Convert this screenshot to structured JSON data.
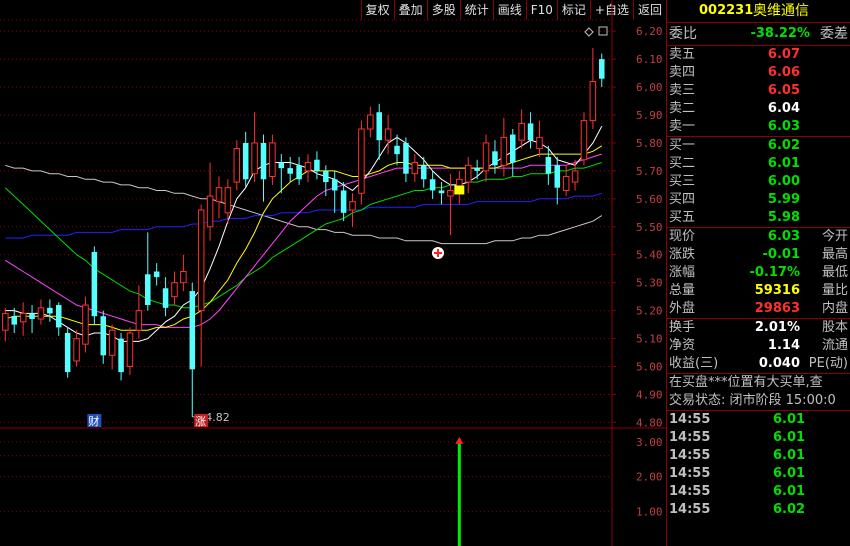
{
  "toolbar": [
    "复权",
    "叠加",
    "多股",
    "统计",
    "画线",
    "F10",
    "标记",
    "+自选",
    "返回"
  ],
  "stock": {
    "code": "002231",
    "name": "奥维通信"
  },
  "weibi": {
    "label": "委比",
    "value": "-38.22%",
    "label2": "委差"
  },
  "sell": [
    {
      "label": "卖五",
      "price": "6.07",
      "color": "red"
    },
    {
      "label": "卖四",
      "price": "6.06",
      "color": "red"
    },
    {
      "label": "卖三",
      "price": "6.05",
      "color": "red"
    },
    {
      "label": "卖二",
      "price": "6.04",
      "color": "white"
    },
    {
      "label": "卖一",
      "price": "6.03",
      "color": "green"
    }
  ],
  "buy": [
    {
      "label": "买一",
      "price": "6.02",
      "color": "green"
    },
    {
      "label": "买二",
      "price": "6.01",
      "color": "green"
    },
    {
      "label": "买三",
      "price": "6.00",
      "color": "green"
    },
    {
      "label": "买四",
      "price": "5.99",
      "color": "green"
    },
    {
      "label": "买五",
      "price": "5.98",
      "color": "green"
    }
  ],
  "quote": [
    {
      "label": "现价",
      "value": "6.03",
      "color": "green",
      "label2": "今开"
    },
    {
      "label": "涨跌",
      "value": "-0.01",
      "color": "green",
      "label2": "最高"
    },
    {
      "label": "涨幅",
      "value": "-0.17%",
      "color": "green",
      "label2": "最低"
    },
    {
      "label": "总量",
      "value": "59316",
      "color": "yellow",
      "label2": "量比"
    },
    {
      "label": "外盘",
      "value": "29863",
      "color": "red",
      "label2": "内盘"
    }
  ],
  "fund": [
    {
      "label": "换手",
      "value": "2.01%",
      "color": "white",
      "label2": "股本"
    },
    {
      "label": "净资",
      "value": "1.14",
      "color": "white",
      "label2": "流通"
    },
    {
      "label": "收益(三)",
      "value": "0.040",
      "color": "white",
      "label2": "PE(动)"
    }
  ],
  "info_line": "在买盘***位置有大买单,查",
  "trade_status": "交易状态: 闭市阶段 15:00:0",
  "ticks": [
    {
      "time": "14:55",
      "price": "6.01"
    },
    {
      "time": "14:55",
      "price": "6.01"
    },
    {
      "time": "14:55",
      "price": "6.01"
    },
    {
      "time": "14:55",
      "price": "6.01"
    },
    {
      "time": "14:55",
      "price": "6.01"
    },
    {
      "time": "14:55",
      "price": "6.02"
    }
  ],
  "main_axis": [
    "6.20",
    "6.10",
    "6.00",
    "5.90",
    "5.80",
    "5.70",
    "5.60",
    "5.50",
    "5.40",
    "5.30",
    "5.20",
    "5.10",
    "5.00",
    "4.90",
    "4.80"
  ],
  "sub_axis": [
    "3.00",
    "2.00",
    "1.00"
  ],
  "low_marker": "4.82",
  "event_labels": [
    "财",
    "涨"
  ],
  "colors": {
    "up": "#ff3030",
    "down": "#55ffff",
    "grid": "#8b0000",
    "ma5": "#ffffff",
    "ma10": "#ffff00",
    "ma20": "#ff44ff",
    "ma30": "#00dd00",
    "ma60": "#2222ff",
    "ma120": "#c8c8c8"
  },
  "chart_data": {
    "type": "candlestick",
    "ylim": [
      4.78,
      6.24
    ],
    "candles": [
      [
        5.13,
        5.19,
        5.21,
        5.09
      ],
      [
        5.18,
        5.15,
        5.21,
        5.12
      ],
      [
        5.16,
        5.19,
        5.23,
        5.11
      ],
      [
        5.19,
        5.17,
        5.22,
        5.12
      ],
      [
        5.17,
        5.21,
        5.24,
        5.15
      ],
      [
        5.21,
        5.19,
        5.24,
        5.16
      ],
      [
        5.22,
        5.14,
        5.23,
        5.11
      ],
      [
        5.12,
        4.98,
        5.14,
        4.96
      ],
      [
        5.02,
        5.1,
        5.13,
        5.0
      ],
      [
        5.08,
        5.22,
        5.25,
        5.05
      ],
      [
        5.41,
        5.18,
        5.43,
        5.15
      ],
      [
        5.18,
        5.04,
        5.2,
        5.01
      ],
      [
        5.04,
        5.13,
        5.15,
        4.99
      ],
      [
        5.1,
        4.98,
        5.12,
        4.95
      ],
      [
        5.0,
        5.12,
        5.14,
        4.97
      ],
      [
        5.13,
        5.2,
        5.29,
        5.1
      ],
      [
        5.33,
        5.22,
        5.48,
        5.2
      ],
      [
        5.34,
        5.32,
        5.37,
        5.29
      ],
      [
        5.28,
        5.21,
        5.32,
        5.18
      ],
      [
        5.25,
        5.3,
        5.34,
        5.22
      ],
      [
        5.3,
        5.34,
        5.4,
        5.27
      ],
      [
        5.27,
        4.99,
        5.3,
        4.82
      ],
      [
        5.2,
        5.56,
        5.58,
        5.0
      ],
      [
        5.5,
        5.61,
        5.73,
        5.45
      ],
      [
        5.59,
        5.64,
        5.68,
        5.53
      ],
      [
        5.55,
        5.64,
        5.67,
        5.51
      ],
      [
        5.66,
        5.78,
        5.81,
        5.63
      ],
      [
        5.8,
        5.67,
        5.84,
        5.64
      ],
      [
        5.69,
        5.8,
        5.91,
        5.66
      ],
      [
        5.8,
        5.67,
        5.83,
        5.59
      ],
      [
        5.68,
        5.8,
        5.83,
        5.65
      ],
      [
        5.73,
        5.71,
        5.76,
        5.62
      ],
      [
        5.71,
        5.69,
        5.75,
        5.66
      ],
      [
        5.72,
        5.67,
        5.75,
        5.65
      ],
      [
        5.7,
        5.73,
        5.76,
        5.66
      ],
      [
        5.74,
        5.7,
        5.77,
        5.67
      ],
      [
        5.7,
        5.66,
        5.72,
        5.61
      ],
      [
        5.67,
        5.63,
        5.7,
        5.55
      ],
      [
        5.63,
        5.55,
        5.66,
        5.52
      ],
      [
        5.56,
        5.59,
        5.62,
        5.5
      ],
      [
        5.62,
        5.85,
        5.88,
        5.58
      ],
      [
        5.85,
        5.9,
        5.93,
        5.82
      ],
      [
        5.91,
        5.81,
        5.94,
        5.74
      ],
      [
        5.81,
        5.85,
        5.9,
        5.76
      ],
      [
        5.79,
        5.76,
        5.83,
        5.72
      ],
      [
        5.8,
        5.69,
        5.82,
        5.66
      ],
      [
        5.69,
        5.73,
        5.76,
        5.66
      ],
      [
        5.72,
        5.67,
        5.75,
        5.64
      ],
      [
        5.67,
        5.63,
        5.7,
        5.6
      ],
      [
        5.63,
        5.62,
        5.66,
        5.58
      ],
      [
        5.61,
        5.63,
        5.69,
        5.47
      ],
      [
        5.64,
        5.67,
        5.7,
        5.58
      ],
      [
        5.66,
        5.72,
        5.75,
        5.62
      ],
      [
        5.71,
        5.7,
        5.74,
        5.67
      ],
      [
        5.7,
        5.8,
        5.83,
        5.66
      ],
      [
        5.77,
        5.72,
        5.81,
        5.69
      ],
      [
        5.72,
        5.82,
        5.89,
        5.68
      ],
      [
        5.83,
        5.73,
        5.85,
        5.68
      ],
      [
        5.81,
        5.87,
        5.92,
        5.78
      ],
      [
        5.87,
        5.81,
        5.91,
        5.78
      ],
      [
        5.78,
        5.82,
        5.88,
        5.75
      ],
      [
        5.75,
        5.69,
        5.79,
        5.65
      ],
      [
        5.72,
        5.64,
        5.75,
        5.58
      ],
      [
        5.63,
        5.68,
        5.72,
        5.61
      ],
      [
        5.66,
        5.7,
        5.74,
        5.63
      ],
      [
        5.74,
        5.88,
        5.91,
        5.72
      ],
      [
        5.88,
        6.02,
        6.14,
        5.85
      ],
      [
        6.1,
        6.03,
        6.12,
        6.0
      ]
    ],
    "ma5": [
      5.2,
      5.2,
      5.19,
      5.19,
      5.19,
      5.18,
      5.16,
      5.14,
      5.12,
      5.11,
      5.12,
      5.12,
      5.11,
      5.09,
      5.09,
      5.09,
      5.1,
      5.13,
      5.16,
      5.18,
      5.22,
      5.24,
      5.28,
      5.35,
      5.43,
      5.52,
      5.6,
      5.64,
      5.7,
      5.72,
      5.73,
      5.73,
      5.73,
      5.72,
      5.71,
      5.69,
      5.68,
      5.67,
      5.65,
      5.63,
      5.66,
      5.7,
      5.75,
      5.8,
      5.82,
      5.8,
      5.77,
      5.74,
      5.7,
      5.67,
      5.65,
      5.65,
      5.66,
      5.68,
      5.71,
      5.73,
      5.75,
      5.77,
      5.79,
      5.81,
      5.8,
      5.78,
      5.74,
      5.73,
      5.72,
      5.76,
      5.8,
      5.86
    ],
    "ma10": [
      5.17,
      5.18,
      5.18,
      5.18,
      5.18,
      5.18,
      5.18,
      5.17,
      5.16,
      5.15,
      5.15,
      5.15,
      5.14,
      5.13,
      5.13,
      5.13,
      5.13,
      5.14,
      5.14,
      5.15,
      5.17,
      5.18,
      5.2,
      5.23,
      5.27,
      5.31,
      5.37,
      5.42,
      5.48,
      5.55,
      5.6,
      5.63,
      5.66,
      5.68,
      5.7,
      5.7,
      5.7,
      5.7,
      5.69,
      5.68,
      5.68,
      5.69,
      5.7,
      5.72,
      5.73,
      5.73,
      5.72,
      5.72,
      5.72,
      5.72,
      5.71,
      5.71,
      5.71,
      5.71,
      5.71,
      5.71,
      5.72,
      5.73,
      5.74,
      5.75,
      5.76,
      5.76,
      5.76,
      5.76,
      5.76,
      5.76,
      5.77,
      5.79
    ],
    "ma20": [
      5.38,
      5.36,
      5.34,
      5.32,
      5.3,
      5.28,
      5.26,
      5.24,
      5.22,
      5.21,
      5.2,
      5.19,
      5.18,
      5.17,
      5.16,
      5.15,
      5.15,
      5.15,
      5.14,
      5.14,
      5.14,
      5.14,
      5.15,
      5.17,
      5.2,
      5.24,
      5.28,
      5.32,
      5.36,
      5.4,
      5.44,
      5.48,
      5.52,
      5.55,
      5.58,
      5.61,
      5.63,
      5.64,
      5.65,
      5.66,
      5.67,
      5.68,
      5.69,
      5.7,
      5.71,
      5.71,
      5.71,
      5.71,
      5.71,
      5.71,
      5.71,
      5.71,
      5.71,
      5.71,
      5.71,
      5.71,
      5.71,
      5.71,
      5.71,
      5.72,
      5.72,
      5.72,
      5.72,
      5.72,
      5.73,
      5.74,
      5.75,
      5.76
    ],
    "ma30": [
      5.64,
      5.61,
      5.58,
      5.55,
      5.52,
      5.49,
      5.46,
      5.43,
      5.4,
      5.38,
      5.35,
      5.33,
      5.31,
      5.29,
      5.27,
      5.26,
      5.24,
      5.23,
      5.22,
      5.22,
      5.21,
      5.21,
      5.22,
      5.23,
      5.25,
      5.27,
      5.29,
      5.32,
      5.34,
      5.36,
      5.39,
      5.41,
      5.43,
      5.45,
      5.47,
      5.49,
      5.51,
      5.52,
      5.53,
      5.55,
      5.56,
      5.58,
      5.59,
      5.6,
      5.61,
      5.62,
      5.63,
      5.63,
      5.64,
      5.64,
      5.65,
      5.65,
      5.66,
      5.66,
      5.67,
      5.67,
      5.67,
      5.68,
      5.68,
      5.69,
      5.69,
      5.69,
      5.7,
      5.7,
      5.71,
      5.71,
      5.72,
      5.73
    ],
    "ma60": [
      5.46,
      5.46,
      5.46,
      5.47,
      5.47,
      5.47,
      5.47,
      5.47,
      5.48,
      5.48,
      5.48,
      5.48,
      5.48,
      5.49,
      5.49,
      5.49,
      5.49,
      5.5,
      5.5,
      5.5,
      5.5,
      5.51,
      5.51,
      5.52,
      5.52,
      5.53,
      5.53,
      5.53,
      5.54,
      5.54,
      5.54,
      5.55,
      5.55,
      5.55,
      5.55,
      5.56,
      5.56,
      5.56,
      5.56,
      5.56,
      5.56,
      5.57,
      5.57,
      5.57,
      5.57,
      5.57,
      5.57,
      5.58,
      5.58,
      5.58,
      5.58,
      5.58,
      5.58,
      5.59,
      5.59,
      5.59,
      5.59,
      5.59,
      5.59,
      5.59,
      5.6,
      5.6,
      5.6,
      5.6,
      5.61,
      5.61,
      5.61,
      5.62
    ],
    "ma120": [
      5.72,
      5.71,
      5.71,
      5.7,
      5.7,
      5.69,
      5.69,
      5.68,
      5.68,
      5.67,
      5.67,
      5.66,
      5.66,
      5.65,
      5.65,
      5.64,
      5.64,
      5.63,
      5.63,
      5.62,
      5.62,
      5.61,
      5.6,
      5.6,
      5.59,
      5.58,
      5.57,
      5.56,
      5.55,
      5.54,
      5.53,
      5.52,
      5.51,
      5.5,
      5.5,
      5.49,
      5.49,
      5.48,
      5.48,
      5.47,
      5.47,
      5.47,
      5.46,
      5.46,
      5.46,
      5.45,
      5.45,
      5.45,
      5.45,
      5.44,
      5.44,
      5.44,
      5.44,
      5.44,
      5.44,
      5.45,
      5.45,
      5.45,
      5.46,
      5.46,
      5.47,
      5.47,
      5.48,
      5.49,
      5.5,
      5.51,
      5.52,
      5.54
    ],
    "indicator": {
      "ylim": [
        0,
        3.4
      ],
      "bars": [
        {
          "index": 51,
          "value": 3.0
        }
      ]
    }
  }
}
